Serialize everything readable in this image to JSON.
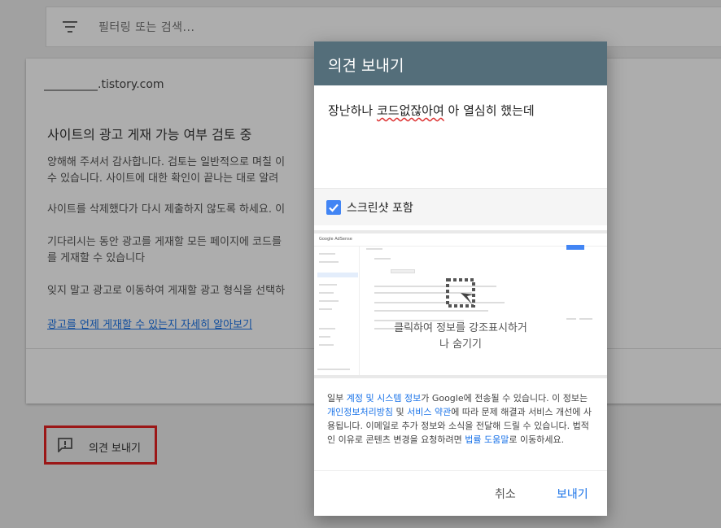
{
  "background": {
    "filter_placeholder": "필터링 또는 검색...",
    "site_domain": ".tistory.com",
    "review_title": "사이트의 광고 게재 가능 여부 검토 중",
    "paragraphs": [
      "양해해 주셔서 감사합니다. 검토는 일반적으로 며칠 이",
      "수 있습니다. 사이트에 대한 확인이 끝나는 대로 알려",
      "사이트를 삭제했다가 다시 제출하지 않도록 하세요. 이",
      "기다리시는 동안 광고를 게재할 모든 페이지에 코드를",
      "를 게재할 수 있습니다",
      "잊지 말고 광고로 이동하여 게재할 광고 형식을 선택하"
    ],
    "learn_more_link": "광고를 언제 게재할 수 있는지 자세히 알아보기",
    "feedback_button_label": "의견 보내기"
  },
  "dialog": {
    "title": "의견 보내기",
    "feedback_text_pre": "장난하나 ",
    "feedback_text_squiggle": "코드없잖아여",
    "feedback_text_post": " 아 열심히 했는데",
    "include_screenshot_label": "스크린샷 포함",
    "include_screenshot_checked": true,
    "preview_logo": "Google AdSense",
    "preview_hint_line1": "클릭하여 정보를 강조표시하거",
    "preview_hint_line2": "나 숨기기",
    "legal": {
      "t1": "일부 ",
      "link1": "계정 및 시스템 정보",
      "t2": "가 Google에 전송될 수 있습니다. 이 정보는 ",
      "link2": "개인정보처리방침",
      "t3": " 및 ",
      "link3": "서비스 약관",
      "t4": "에 따라 문제 해결과 서비스 개선에 사용됩니다. 이메일로 추가 정보와 소식을 전달해 드릴 수 있습니다. 법적인 이유로 콘텐츠 변경을 요청하려면 ",
      "link4": "법률 도움말",
      "t5": "로 이동하세요."
    },
    "cancel_label": "취소",
    "send_label": "보내기"
  },
  "colors": {
    "header": "#546e7a",
    "accent": "#1a73e8",
    "highlight_border": "#e52222"
  }
}
